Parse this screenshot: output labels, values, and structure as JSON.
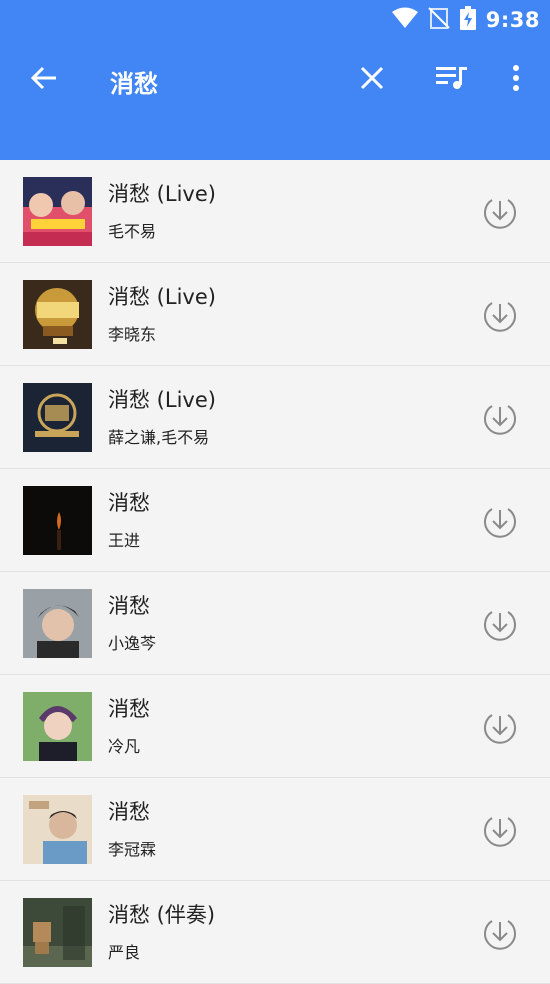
{
  "status": {
    "time": "9:38"
  },
  "appbar": {
    "title": "消愁"
  },
  "icons": {
    "back": "arrow-left-icon",
    "clear": "close-icon",
    "queue": "playlist-music-icon",
    "more": "more-vertical-icon",
    "download": "download-circle-icon",
    "wifi": "wifi-icon",
    "signal": "no-signal-icon",
    "battery": "battery-charging-icon"
  },
  "colors": {
    "primary": "#4286f5",
    "background": "#f4f4f4",
    "divider": "#e2e2e2",
    "icon_gray": "#8a8a8a"
  },
  "songs": [
    {
      "title": "消愁 (Live)",
      "artist": "毛不易"
    },
    {
      "title": "消愁 (Live)",
      "artist": "李晓东"
    },
    {
      "title": "消愁 (Live)",
      "artist": "薛之谦,毛不易"
    },
    {
      "title": "消愁",
      "artist": "王进"
    },
    {
      "title": "消愁",
      "artist": "小逸芩"
    },
    {
      "title": "消愁",
      "artist": "冷凡"
    },
    {
      "title": "消愁",
      "artist": "李冠霖"
    },
    {
      "title": "消愁 (伴奏)",
      "artist": "严良"
    }
  ]
}
